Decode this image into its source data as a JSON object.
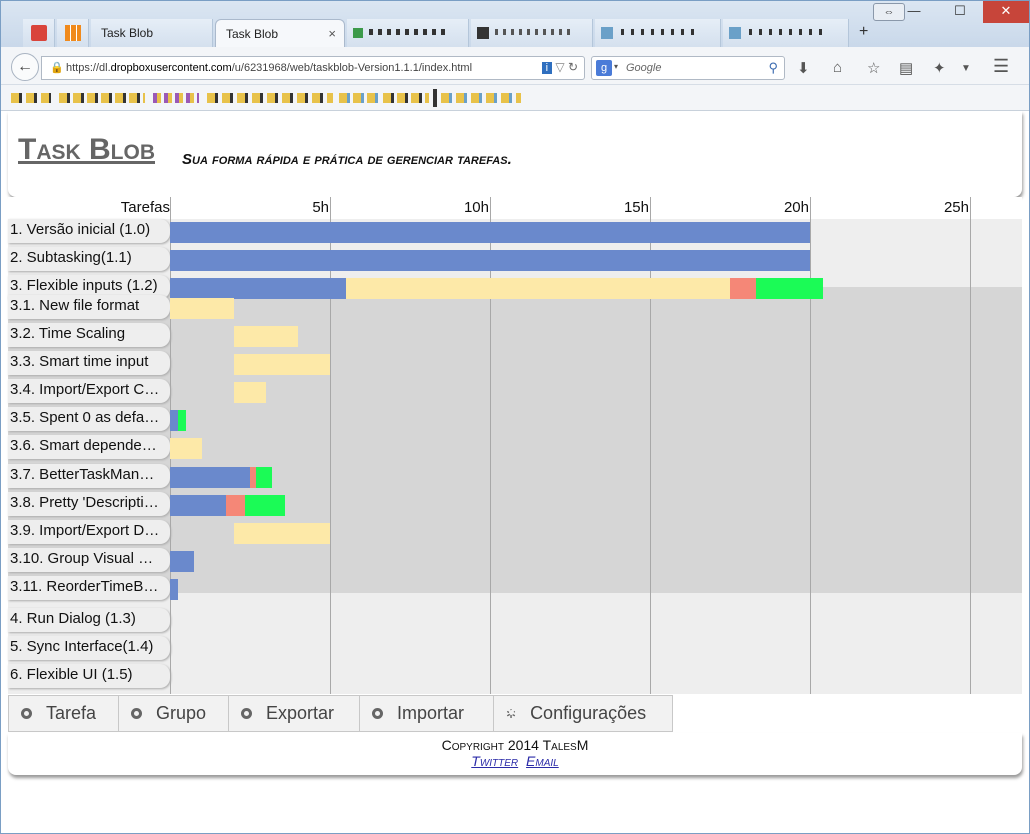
{
  "browser": {
    "tabs": [
      {
        "label": "",
        "icon": "gmail-icon"
      },
      {
        "label": "",
        "icon": "orange-grid-icon"
      },
      {
        "label": "Task Blob",
        "active": false
      },
      {
        "label": "Task Blob",
        "active": true,
        "close": "×"
      },
      {
        "label": "",
        "icon": "pixel-tab-icon"
      },
      {
        "label": "",
        "icon": "pixel-tab-icon"
      },
      {
        "label": "",
        "icon": "pixel-tab-icon"
      },
      {
        "label": "",
        "icon": "pixel-tab-icon"
      }
    ],
    "new_tab": "+",
    "window_controls": {
      "minimize": "—",
      "maximize": "☐",
      "close": "✕",
      "restore": "⇔"
    },
    "url_prefix": "https://dl.",
    "url_domain": "dropboxusercontent.com",
    "url_path": "/u/6231968/web/taskblob-Version1.1.1/index.html",
    "search_placeholder": "Google",
    "icons": [
      "back-arrow-icon",
      "lock-icon",
      "info-icon",
      "reload-icon",
      "download-icon",
      "home-icon",
      "bookmark-star-icon",
      "reader-icon",
      "addon-icon",
      "menu-icon"
    ]
  },
  "app": {
    "title": "Task Blob",
    "subtitle": "Sua forma rápida e prática de gerenciar tarefas."
  },
  "gantt": {
    "header_label": "Tarefas",
    "hour_labels": [
      "5h",
      "10h",
      "15h",
      "20h",
      "25h"
    ],
    "rows": [
      {
        "label": "1. Versão inicial (1.0)",
        "group": 1
      },
      {
        "label": "2. Subtasking(1.1)",
        "group": 1
      },
      {
        "label": "3. Flexible inputs (1.2)",
        "group": 1
      },
      {
        "label": "3.1. New file format",
        "group": 3
      },
      {
        "label": "3.2. Time Scaling",
        "group": 3
      },
      {
        "label": "3.3. Smart time input",
        "group": 3
      },
      {
        "label": "3.4. Import/Export C…",
        "group": 3
      },
      {
        "label": "3.5. Spent 0 as defa…",
        "group": 3
      },
      {
        "label": "3.6. Smart depende…",
        "group": 3
      },
      {
        "label": "3.7. BetterTaskMan…",
        "group": 3
      },
      {
        "label": "3.8. Pretty 'Descripti…",
        "group": 3
      },
      {
        "label": "3.9. Import/Export D…",
        "group": 3
      },
      {
        "label": "3.10. Group Visual …",
        "group": 3
      },
      {
        "label": "3.11. ReorderTimeB…",
        "group": 3
      },
      {
        "label": "4. Run Dialog (1.3)",
        "group": 1
      },
      {
        "label": "5. Sync Interface(1.4)",
        "group": 1
      },
      {
        "label": "6. Flexible UI (1.5)",
        "group": 1
      }
    ],
    "bars": [
      {
        "row": 0,
        "segments": [
          {
            "start": 0,
            "end": 20,
            "kind": "blue"
          }
        ]
      },
      {
        "row": 1,
        "segments": [
          {
            "start": 0,
            "end": 20,
            "kind": "blue"
          }
        ]
      },
      {
        "row": 2,
        "segments": [
          {
            "start": 0,
            "end": 5.5,
            "kind": "blue"
          },
          {
            "start": 5.5,
            "end": 17.5,
            "kind": "yellow"
          },
          {
            "start": 17.5,
            "end": 18.3,
            "kind": "red"
          },
          {
            "start": 18.3,
            "end": 20.4,
            "kind": "green"
          }
        ]
      },
      {
        "row": 3,
        "segments": [
          {
            "start": 0,
            "end": 2,
            "kind": "yellow"
          }
        ]
      },
      {
        "row": 4,
        "segments": [
          {
            "start": 2,
            "end": 4,
            "kind": "yellow"
          }
        ]
      },
      {
        "row": 5,
        "segments": [
          {
            "start": 2,
            "end": 5,
            "kind": "yellow"
          }
        ]
      },
      {
        "row": 6,
        "segments": [
          {
            "start": 2,
            "end": 3,
            "kind": "yellow"
          }
        ]
      },
      {
        "row": 7,
        "segments": [
          {
            "start": 0,
            "end": 0.25,
            "kind": "blue"
          },
          {
            "start": 0.25,
            "end": 0.5,
            "kind": "green"
          }
        ]
      },
      {
        "row": 8,
        "segments": [
          {
            "start": 0,
            "end": 1,
            "kind": "yellow"
          }
        ]
      },
      {
        "row": 9,
        "segments": [
          {
            "start": 0,
            "end": 2.5,
            "kind": "blue"
          },
          {
            "start": 2.5,
            "end": 2.7,
            "kind": "red"
          },
          {
            "start": 2.7,
            "end": 3.2,
            "kind": "green"
          }
        ]
      },
      {
        "row": 10,
        "segments": [
          {
            "start": 0,
            "end": 1.75,
            "kind": "blue"
          },
          {
            "start": 1.75,
            "end": 2.35,
            "kind": "red"
          },
          {
            "start": 2.35,
            "end": 3.6,
            "kind": "green"
          }
        ]
      },
      {
        "row": 11,
        "segments": [
          {
            "start": 2,
            "end": 5,
            "kind": "yellow"
          }
        ]
      },
      {
        "row": 12,
        "segments": [
          {
            "start": 0,
            "end": 0.75,
            "kind": "blue"
          }
        ]
      },
      {
        "row": 13,
        "segments": [
          {
            "start": 0,
            "end": 0.25,
            "kind": "blue"
          }
        ]
      }
    ],
    "colors": {
      "blue": "#6a89cc",
      "yellow": "#fde9a8",
      "red": "#f58777",
      "green": "#1bfb56"
    }
  },
  "toolbar": {
    "buttons": [
      {
        "label": "Tarefa",
        "icon": "add-circle-icon"
      },
      {
        "label": "Grupo",
        "icon": "add-circle-icon"
      },
      {
        "label": "Exportar",
        "icon": "download-circle-icon"
      },
      {
        "label": "Importar",
        "icon": "upload-circle-icon"
      },
      {
        "label": "Configurações",
        "icon": "gear-icon"
      }
    ]
  },
  "footer": {
    "copyright": "Copyright 2014 TalesM",
    "twitter": "Twitter",
    "email": "Email"
  }
}
